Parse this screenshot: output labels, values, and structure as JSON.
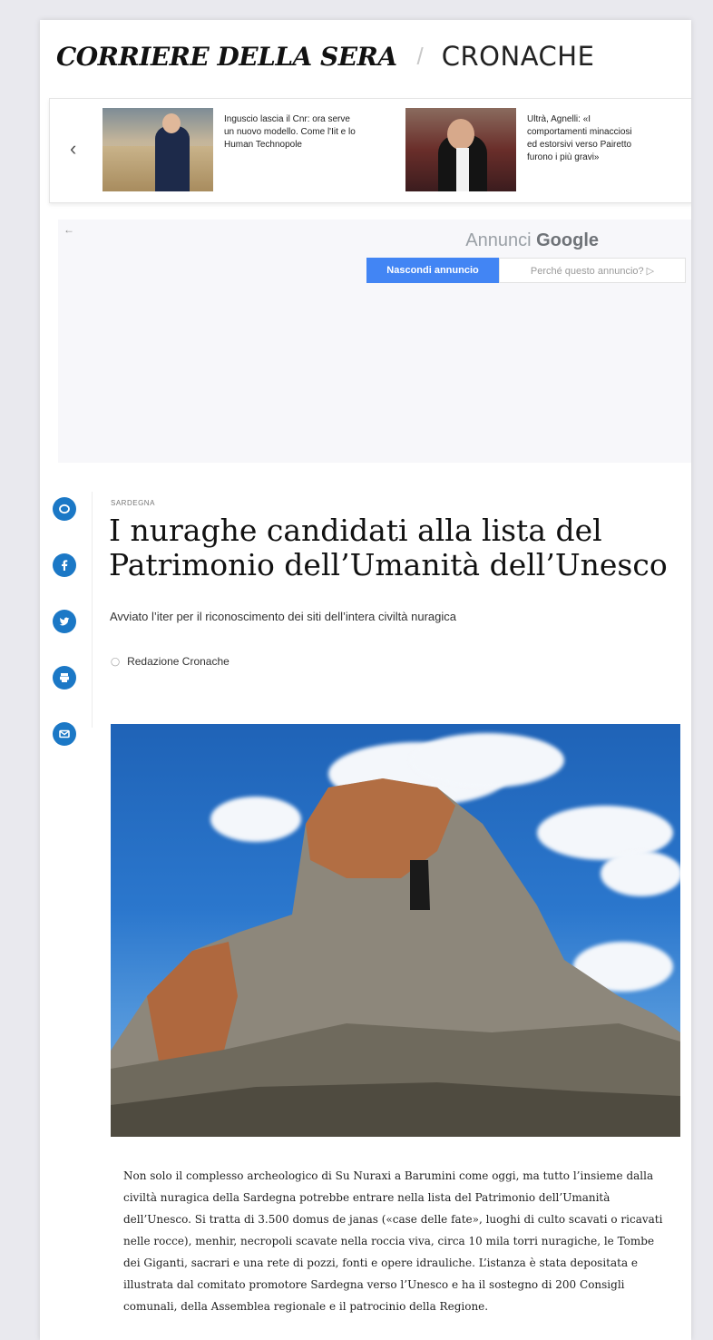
{
  "header": {
    "logo": "CORRIERE DELLA SERA",
    "separator": "/",
    "section": "CRONACHE"
  },
  "carousel": {
    "prev_icon": "chevron-left-icon",
    "items": [
      {
        "text": "Inguscio lascia il Cnr: ora serve un nuovo modello. Come l'Iit e lo Human Technopole"
      },
      {
        "text": "Ultrà, Agnelli: «I comportamenti minacciosi ed estorsivi verso Pairetto furono i più gravi»"
      }
    ]
  },
  "ad": {
    "back_icon": "arrow-left-icon",
    "label_prefix": "Annunci",
    "label_brand": "Google",
    "hide_label": "Nascondi annuncio",
    "why_label": "Perché questo annuncio? ▷"
  },
  "share": {
    "icons": [
      "comment-icon",
      "facebook-icon",
      "twitter-icon",
      "print-icon",
      "email-icon"
    ]
  },
  "article": {
    "kicker": "SARDEGNA",
    "title": "I nuraghe candidati alla lista del Patrimonio dell’Umanità dell’Unesco",
    "subtitle": "Avviato l’iter per il riconoscimento dei siti dell’intera civiltà nuragica",
    "author": "Redazione Cronache",
    "body": "Non solo il complesso archeologico di Su Nuraxi a Barumini come oggi, ma tutto l’insieme dalla civiltà nuragica della Sardegna potrebbe entrare nella lista del Patrimonio dell’Umanità dell’Unesco. Si tratta di 3.500 domus de janas («case delle fate», luoghi di culto scavati o ricavati nelle rocce), menhir, necropoli scavate nella roccia viva, circa 10 mila torri nuragiche, le Tombe dei Giganti, sacrari e una rete di pozzi, fonti e opere idrauliche. L’istanza è stata depositata e illustrata dal comitato promotore Sardegna verso l’Unesco e ha il sostegno di 200 Consigli comunali, della Assemblea regionale e il patrocinio della Regione."
  },
  "colors": {
    "share_blue": "#1b78c6",
    "ad_button_blue": "#4285f4"
  }
}
